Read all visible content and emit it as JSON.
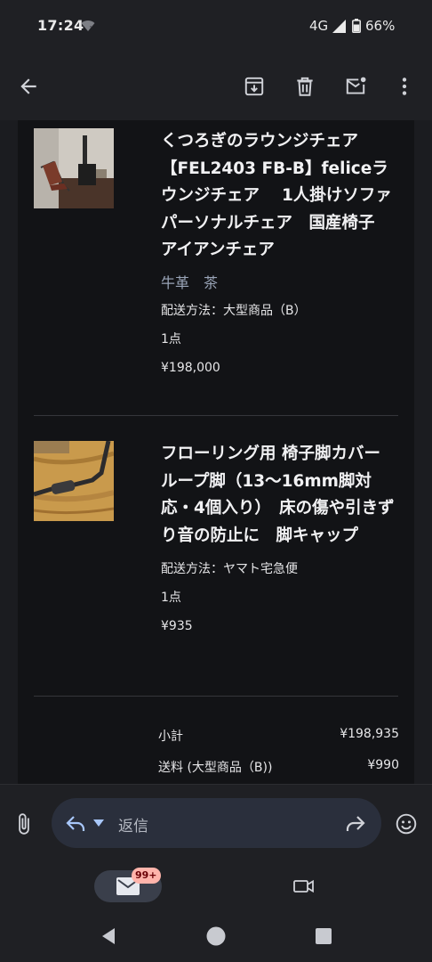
{
  "status_bar": {
    "time": "17:24",
    "network": "4G",
    "battery": "66%"
  },
  "app_bar": {
    "back_icon": "arrow-back-icon",
    "archive_icon": "archive-icon",
    "delete_icon": "trash-icon",
    "unread_icon": "mark-unread-icon",
    "more_icon": "more-vert-icon"
  },
  "order": {
    "items": [
      {
        "title": "くつろぎのラウンジチェア【FEL2403 FB-B】feliceラウンジチェア　 1人掛けソファ　パーソナルチェア　国産椅子　アイアンチェア",
        "variant": "牛革　茶",
        "shipping": "配送方法：大型商品（B）",
        "quantity": "1点",
        "price": "¥198,000"
      },
      {
        "title": "フローリング用 椅子脚カバー ループ脚（13〜16mm脚対応・4個入り）　床の傷や引きずり音の防止に　脚キャップ",
        "shipping": "配送方法：ヤマト宅急便",
        "quantity": "1点",
        "price": "¥935"
      }
    ],
    "summary": {
      "subtotal_label": "小計",
      "subtotal_value": "¥198,935",
      "shipping_label": "送料 (大型商品（B))",
      "shipping_value": "¥990"
    }
  },
  "reply": {
    "placeholder": "返信"
  },
  "bottom_nav": {
    "mail_badge": "99+"
  },
  "colors": {
    "background": "#1b1c20",
    "mail_body": "#121316",
    "accent": "#a8c7fa",
    "badge": "#ffb4ab"
  }
}
